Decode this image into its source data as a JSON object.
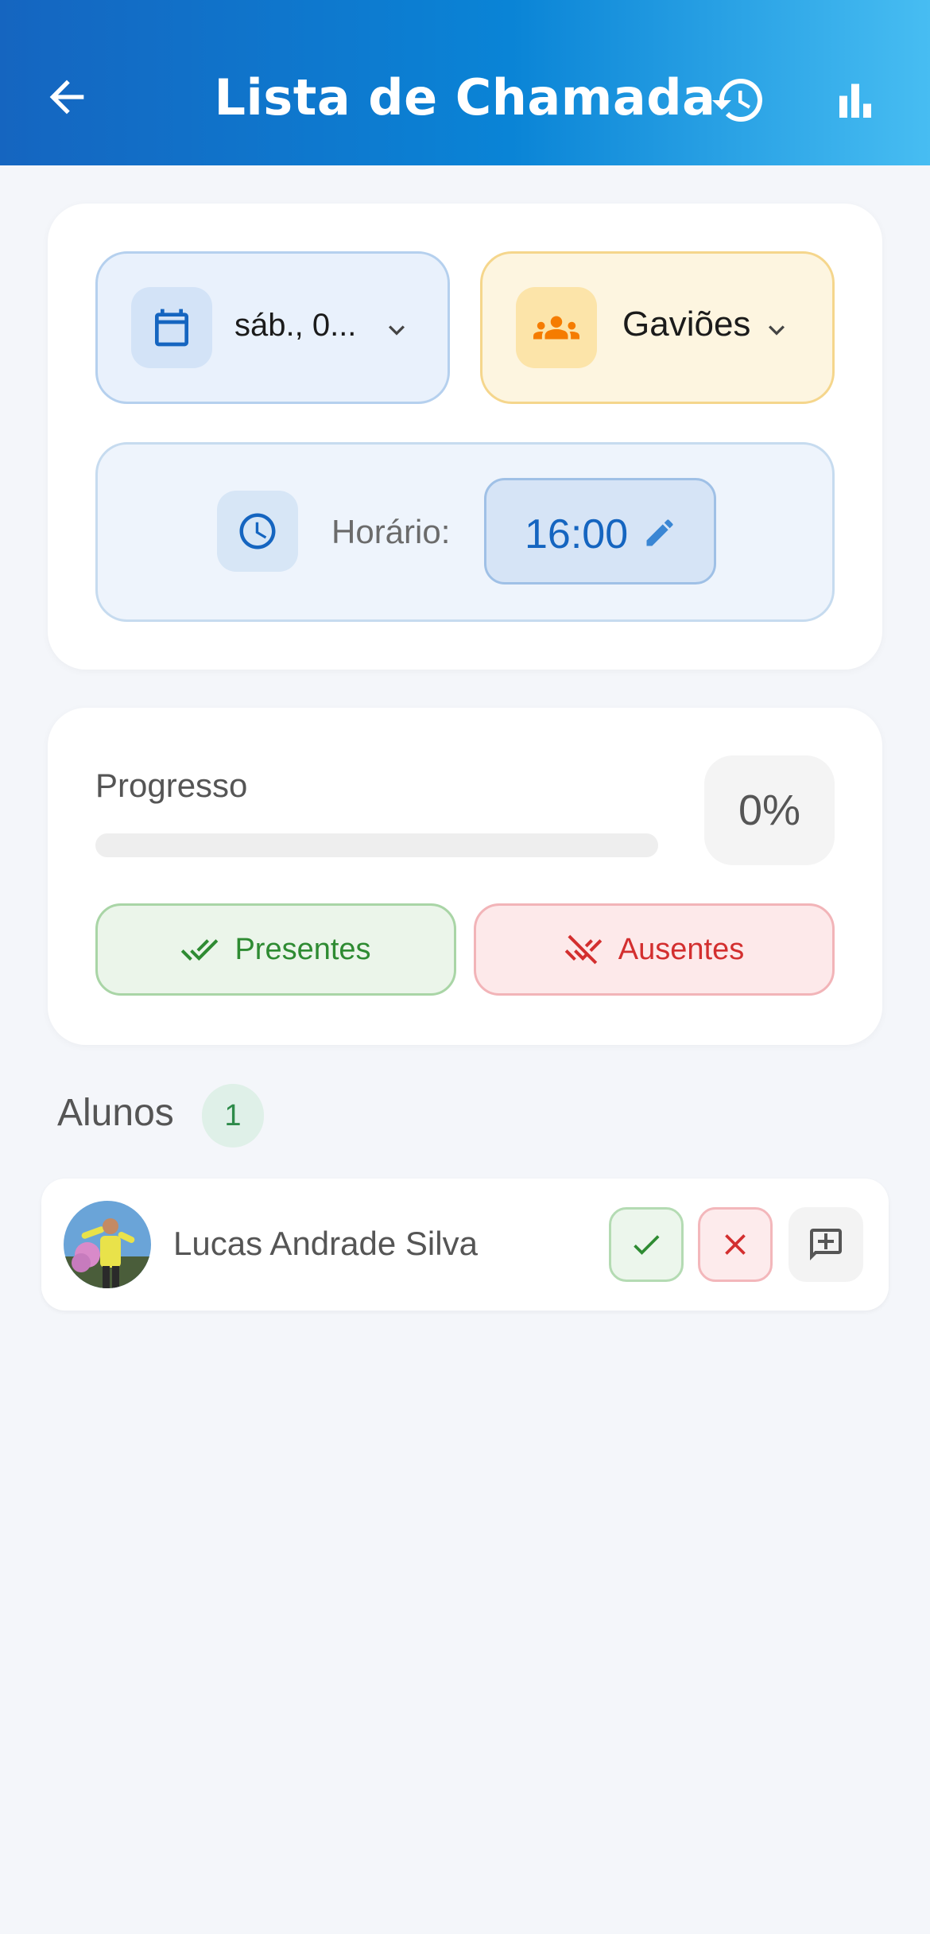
{
  "header": {
    "title": "Lista de Chamada",
    "back_icon": "arrow-back-icon",
    "history_icon": "history-icon",
    "stats_icon": "bar-chart-icon",
    "gradient": [
      "#1565c0",
      "#47bdf2"
    ]
  },
  "filters": {
    "date": {
      "value": "sáb., 0...",
      "icon": "calendar-icon"
    },
    "group": {
      "value": "Gaviões",
      "icon": "groups-icon"
    },
    "time": {
      "label": "Horário:",
      "value": "16:00",
      "icon": "clock-icon",
      "edit_icon": "edit-icon"
    }
  },
  "progress": {
    "label": "Progresso",
    "percent_text": "0%",
    "fraction": 0.0,
    "buttons": {
      "present": "Presentes",
      "absent": "Ausentes"
    }
  },
  "students": {
    "title": "Alunos",
    "count": "1",
    "items": [
      {
        "name": "Lucas Andrade Silva"
      }
    ]
  },
  "colors": {
    "primary": "#1565c0",
    "present": "#2e8b32",
    "absent": "#d32f2f",
    "group_accent": "#f57c00"
  }
}
